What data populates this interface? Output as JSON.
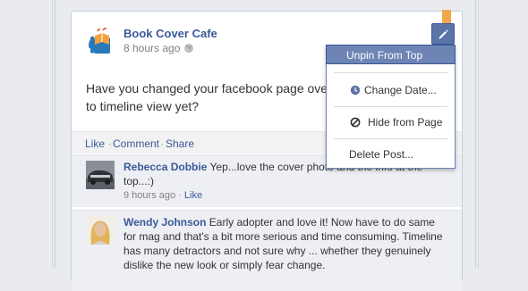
{
  "post": {
    "page_name": "Book Cover Cafe",
    "time": "8 hours ago",
    "text": "Have you changed your facebook page over to timeline view yet?"
  },
  "actions": {
    "like": "Like",
    "sep1": "·",
    "comment": "Comment",
    "sep2": "·",
    "share": "Share"
  },
  "comments": [
    {
      "author": "Rebecca Dobbie",
      "text": "Yep...love the cover photo and the info at the top...:)",
      "time": "9 hours ago",
      "sep": "·",
      "like": "Like"
    },
    {
      "author": "Wendy Johnson",
      "text": "Early adopter and love it! Now have to do same for mag and that's a bit more serious and time consuming. Timeline has many detractors and not sure why ... whether they genuinely dislike the new look or simply fear change."
    }
  ],
  "menu": {
    "unpin": "Unpin From Top",
    "change_date": "Change Date...",
    "hide": "Hide from Page",
    "delete": "Delete Post..."
  },
  "colors": {
    "brand": "#3b5998",
    "menu_highlight": "#6d84b4",
    "pin": "#f0a84b"
  }
}
